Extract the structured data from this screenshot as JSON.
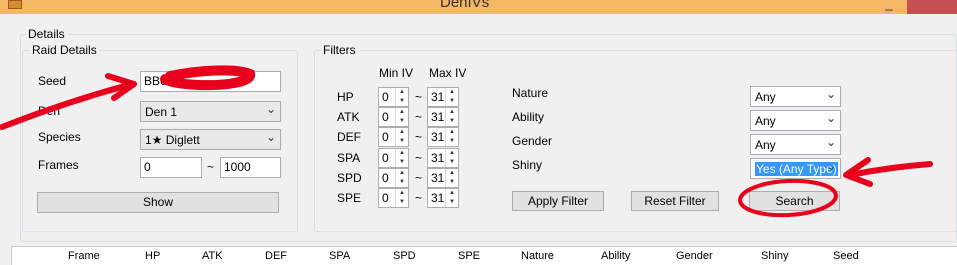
{
  "window": {
    "title": "DenIVs"
  },
  "details_label": "Details",
  "raid": {
    "legend": "Raid Details",
    "seed_label": "Seed",
    "seed_value": "BB62",
    "den_label": "Den",
    "den_value": "Den 1",
    "species_label": "Species",
    "species_value": "1★ Diglett",
    "frames_label": "Frames",
    "frames_start": "0",
    "frames_sep": "~",
    "frames_end": "1000",
    "show_button": "Show"
  },
  "filters": {
    "legend": "Filters",
    "min_iv_header": "Min IV",
    "max_iv_header": "Max IV",
    "tilde": "~",
    "stats": [
      {
        "label": "HP",
        "min": "0",
        "max": "31"
      },
      {
        "label": "ATK",
        "min": "0",
        "max": "31"
      },
      {
        "label": "DEF",
        "min": "0",
        "max": "31"
      },
      {
        "label": "SPA",
        "min": "0",
        "max": "31"
      },
      {
        "label": "SPD",
        "min": "0",
        "max": "31"
      },
      {
        "label": "SPE",
        "min": "0",
        "max": "31"
      }
    ],
    "nature_label": "Nature",
    "nature_value": "Any",
    "ability_label": "Ability",
    "ability_value": "Any",
    "gender_label": "Gender",
    "gender_value": "Any",
    "shiny_label": "Shiny",
    "shiny_value": "Yes (Any Type)",
    "apply_button": "Apply Filter",
    "reset_button": "Reset Filter",
    "search_button": "Search"
  },
  "results_columns": [
    "Frame",
    "HP",
    "ATK",
    "DEF",
    "SPA",
    "SPD",
    "SPE",
    "Nature",
    "Ability",
    "Gender",
    "Shiny",
    "Seed"
  ],
  "annotation_color": "#e8001c"
}
